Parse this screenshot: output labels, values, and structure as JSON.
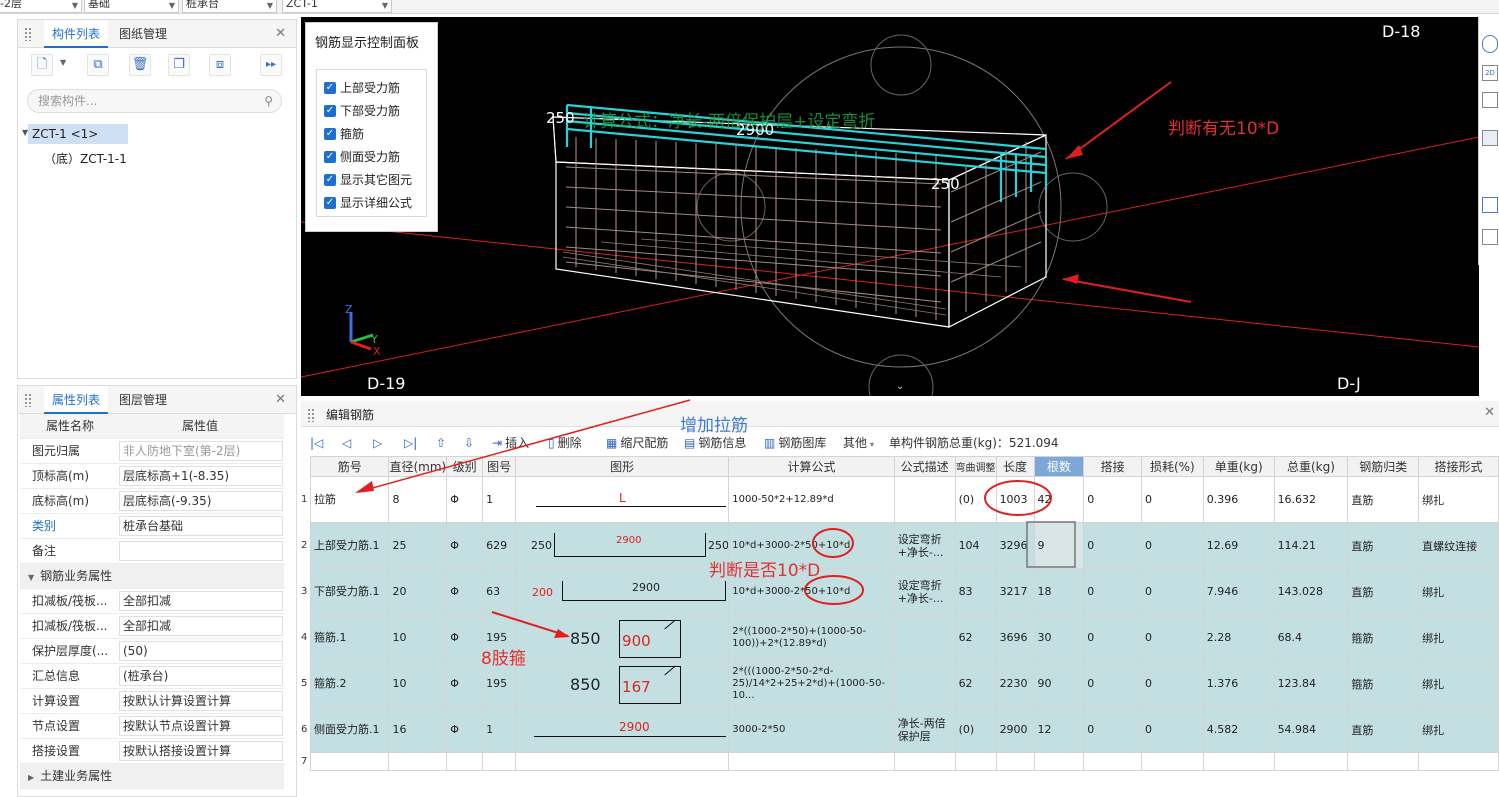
{
  "topbar": {
    "floor": "-2层",
    "category": "基础",
    "type": "桩承台",
    "component": "ZCT-1"
  },
  "left_top": {
    "tabs": [
      "构件列表",
      "图纸管理"
    ],
    "search_placeholder": "搜索构件...",
    "tree": {
      "root": "ZCT-1 <1>",
      "child": "（底）ZCT-1-1"
    }
  },
  "props": {
    "tabs": [
      "属性列表",
      "图层管理"
    ],
    "header": {
      "name": "属性名称",
      "value": "属性值"
    },
    "rows": [
      {
        "k": "图元归属",
        "v": "非人防地下室(第-2层)"
      },
      {
        "k": "顶标高(m)",
        "v": "层底标高+1(-8.35)"
      },
      {
        "k": "底标高(m)",
        "v": "层底标高(-9.35)"
      },
      {
        "k": "类别",
        "v": "桩承台基础"
      },
      {
        "k": "备注",
        "v": ""
      }
    ],
    "group1": "钢筋业务属性",
    "rows2": [
      {
        "k": "扣减板/筏板...",
        "v": "全部扣减"
      },
      {
        "k": "扣减板/筏板...",
        "v": "全部扣减"
      },
      {
        "k": "保护层厚度(...",
        "v": "(50)"
      },
      {
        "k": "汇总信息",
        "v": "(桩承台)"
      },
      {
        "k": "计算设置",
        "v": "按默认计算设置计算"
      },
      {
        "k": "节点设置",
        "v": "按默认节点设置计算"
      },
      {
        "k": "搭接设置",
        "v": "按默认搭接设置计算"
      }
    ],
    "group2": "土建业务属性"
  },
  "control_panel": {
    "title": "钢筋显示控制面板",
    "items": [
      "上部受力筋",
      "下部受力筋",
      "箍筋",
      "侧面受力筋",
      "显示其它图元",
      "显示详细公式"
    ]
  },
  "view3d": {
    "axes": {
      "d18": "D-18",
      "d19": "D-19",
      "dj": "D-J"
    },
    "dims": {
      "top_left": "250",
      "top_mid": "2900",
      "right": "250"
    },
    "overlay_text": "计算公式：净长-两倍保护层+设定弯折"
  },
  "annotations": {
    "judge_10d": "判断有无10*D",
    "add_tie": "增加拉筋",
    "judge_is_10d": "判断是否10*D",
    "eight_legs": "8肢箍"
  },
  "editor": {
    "title": "编辑钢筋",
    "toolbar": [
      "插入",
      "删除",
      "缩尺配筋",
      "钢筋信息",
      "钢筋图库",
      "其他"
    ],
    "total_label": "单构件钢筋总重(kg)：521.094",
    "columns": [
      "筋号",
      "直径(mm)",
      "级别",
      "图号",
      "图形",
      "计算公式",
      "公式描述",
      "弯曲调整",
      "长度",
      "根数",
      "搭接",
      "损耗(%)",
      "单重(kg)",
      "总重(kg)",
      "钢筋归类",
      "搭接形式"
    ],
    "rows": [
      {
        "no": "1",
        "name": "拉筋",
        "d": "8",
        "grade": "Φ",
        "fig": "1",
        "shape": {
          "l": "",
          "m": "L",
          "r": ""
        },
        "formula": "1000-50*2+12.89*d",
        "desc": "",
        "bend": "(0)",
        "len": "1003",
        "count": "42",
        "lap": "0",
        "loss": "0",
        "unit": "0.396",
        "total": "16.632",
        "cls": "直筋",
        "lapform": "绑扎"
      },
      {
        "no": "2",
        "name": "上部受力筋.1",
        "d": "25",
        "grade": "Φ",
        "fig": "629",
        "shape": {
          "l": "250",
          "m": "2900",
          "r": "250"
        },
        "formula": "10*d+3000-2*50+10*d",
        "desc": "设定弯折+净长-...",
        "bend": "104",
        "len": "3296",
        "count": "9",
        "lap": "0",
        "loss": "0",
        "unit": "12.69",
        "total": "114.21",
        "cls": "直筋",
        "lapform": "直螺纹连接"
      },
      {
        "no": "3",
        "name": "下部受力筋.1",
        "d": "20",
        "grade": "Φ",
        "fig": "63",
        "shape": {
          "l": "200",
          "m": "2900",
          "r": ""
        },
        "formula": "10*d+3000-2*50+10*d",
        "desc": "设定弯折+净长-...",
        "bend": "83",
        "len": "3217",
        "count": "18",
        "lap": "0",
        "loss": "0",
        "unit": "7.946",
        "total": "143.028",
        "cls": "直筋",
        "lapform": "绑扎"
      },
      {
        "no": "4",
        "name": "箍筋.1",
        "d": "10",
        "grade": "Φ",
        "fig": "195",
        "shape": {
          "l": "850",
          "m": "900",
          "r": ""
        },
        "formula": "2*((1000-2*50)+(1000-50-100))+2*(12.89*d)",
        "desc": "",
        "bend": "62",
        "len": "3696",
        "count": "30",
        "lap": "0",
        "loss": "0",
        "unit": "2.28",
        "total": "68.4",
        "cls": "箍筋",
        "lapform": "绑扎"
      },
      {
        "no": "5",
        "name": "箍筋.2",
        "d": "10",
        "grade": "Φ",
        "fig": "195",
        "shape": {
          "l": "850",
          "m": "167",
          "r": ""
        },
        "formula": "2*(((1000-2*50-2*d-25)/14*2+25+2*d)+(1000-50-10...",
        "desc": "",
        "bend": "62",
        "len": "2230",
        "count": "90",
        "lap": "0",
        "loss": "0",
        "unit": "1.376",
        "total": "123.84",
        "cls": "箍筋",
        "lapform": "绑扎"
      },
      {
        "no": "6",
        "name": "侧面受力筋.1",
        "d": "16",
        "grade": "Φ",
        "fig": "1",
        "shape": {
          "l": "",
          "m": "2900",
          "r": ""
        },
        "formula": "3000-2*50",
        "desc": "净长-两倍保护层",
        "bend": "(0)",
        "len": "2900",
        "count": "12",
        "lap": "0",
        "loss": "0",
        "unit": "4.582",
        "total": "54.984",
        "cls": "直筋",
        "lapform": "绑扎"
      },
      {
        "no": "7",
        "name": "",
        "d": "",
        "grade": "",
        "fig": "",
        "shape": {
          "l": "",
          "m": "",
          "r": ""
        },
        "formula": "",
        "desc": "",
        "bend": "",
        "len": "",
        "count": "",
        "lap": "",
        "loss": "",
        "unit": "",
        "total": "",
        "cls": "",
        "lapform": ""
      }
    ]
  }
}
